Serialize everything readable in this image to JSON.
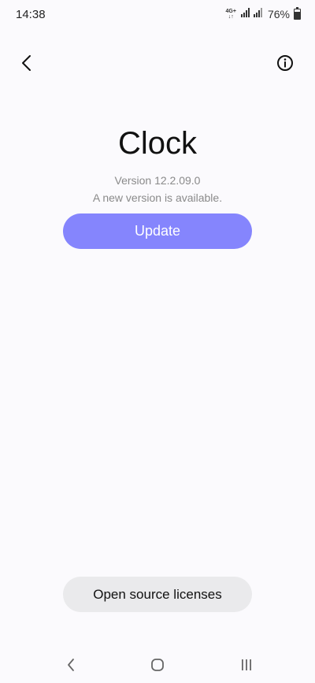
{
  "status_bar": {
    "time": "14:38",
    "network_type": "4G+",
    "battery_percent": "76%",
    "battery_level": 0.76
  },
  "header": {
    "back_icon": "chevron-left-icon",
    "info_icon": "info-circle-icon"
  },
  "app": {
    "title": "Clock",
    "version": "Version 12.2.09.0",
    "update_note": "A new version is available.",
    "update_label": "Update"
  },
  "footer": {
    "licenses_label": "Open source licenses"
  },
  "nav_bar": {
    "back_icon": "nav-back-icon",
    "home_icon": "nav-home-icon",
    "recents_icon": "nav-recents-icon"
  },
  "colors": {
    "background": "#fbfafd",
    "accent": "#8585fd",
    "secondary_button": "#eaeaec",
    "muted_text": "#8a8a8a"
  }
}
